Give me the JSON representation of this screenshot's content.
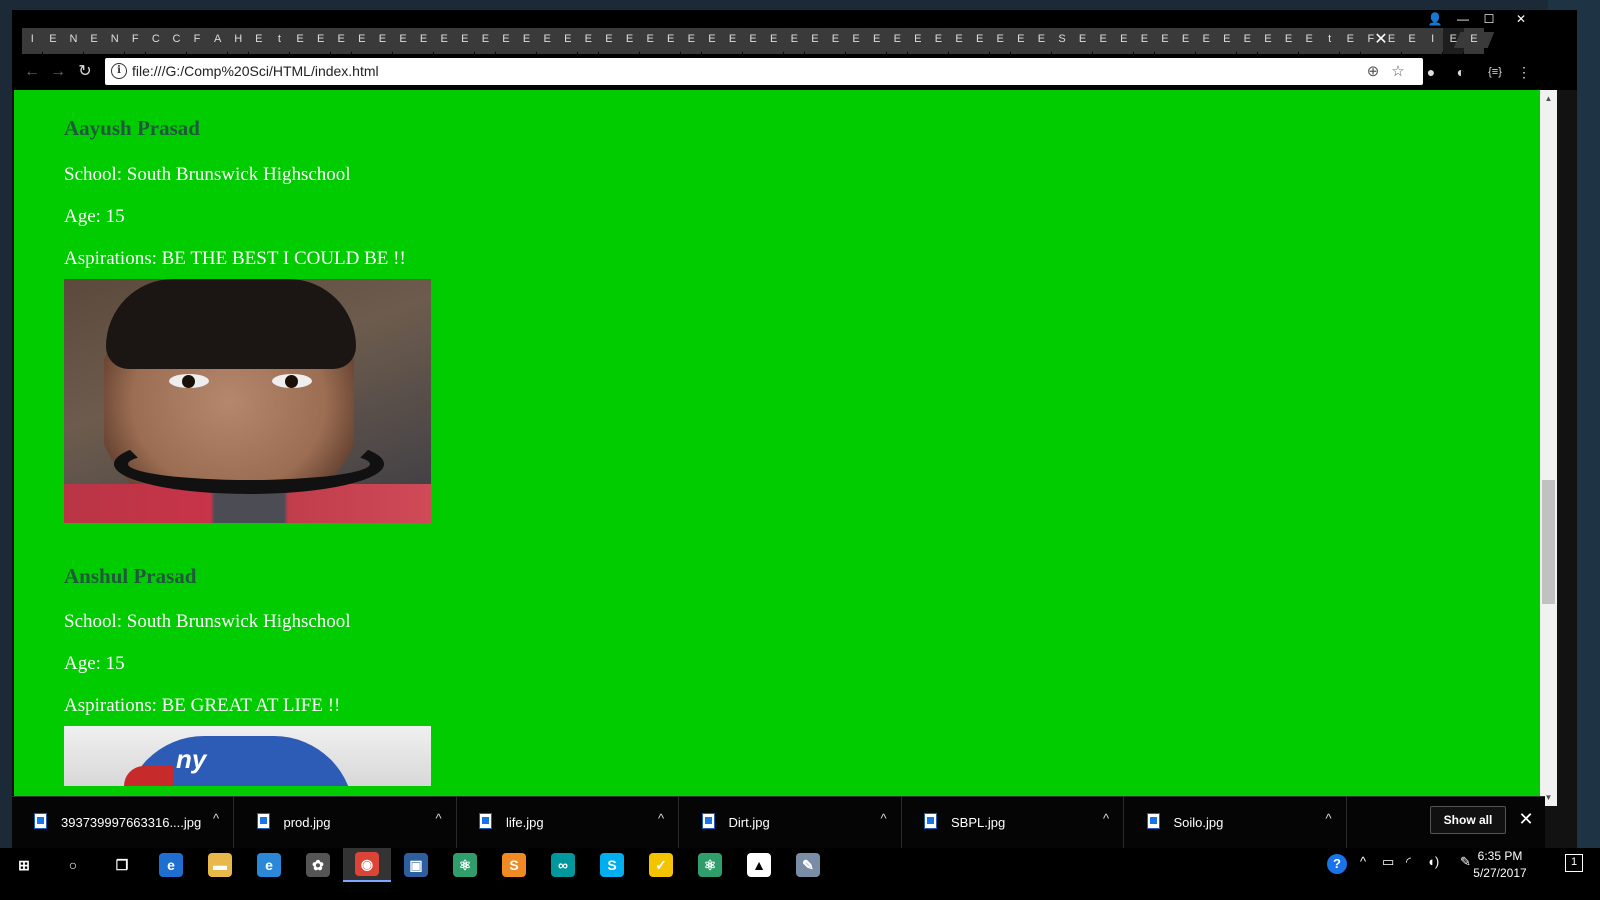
{
  "browser": {
    "tab_letters": [
      "I",
      "E",
      "N",
      "E",
      "N",
      "F",
      "C",
      "C",
      "F",
      "A",
      "H",
      "E",
      "t",
      "E",
      "E",
      "E",
      "E",
      "E",
      "E",
      "E",
      "E",
      "E",
      "E",
      "E",
      "E",
      "E",
      "E",
      "E",
      "E",
      "E",
      "E",
      "E",
      "E",
      "E",
      "E",
      "E",
      "E",
      "E",
      "E",
      "E",
      "E",
      "E",
      "E",
      "E",
      "E",
      "E",
      "E",
      "E",
      "E",
      "E",
      "S",
      "E",
      "E",
      "E",
      "E",
      "E",
      "E",
      "E",
      "E",
      "E",
      "E",
      "E",
      "E",
      "t",
      "E",
      "F",
      "E",
      "E",
      "I",
      "E",
      "E"
    ],
    "tab_close": "✕",
    "url": "file:///G:/Comp%20Sci/HTML/index.html",
    "window_controls": {
      "profile": "👤",
      "minimize": "—",
      "maximize": "☐",
      "close": "✕"
    },
    "nav": {
      "back": "←",
      "forward": "→",
      "reload": "↻"
    },
    "omnibox_icons": {
      "info": "i",
      "zoom": "⊕",
      "star": "☆"
    },
    "extensions": [
      "●",
      "◐",
      "{≡}",
      "⋮"
    ]
  },
  "page": {
    "people": [
      {
        "name": "Aayush Prasad",
        "school": "School: South Brunswick Highschool",
        "age": "Age: 15",
        "aspirations": "Aspirations: BE THE BEST I COULD BE !!"
      },
      {
        "name": "Anshul Prasad",
        "school": "School: South Brunswick Highschool",
        "age": "Age: 15",
        "aspirations": "Aspirations: BE GREAT AT LIFE !!",
        "cap_logo": "ny"
      }
    ]
  },
  "scrollbar": {
    "up": "▲",
    "down": "▼"
  },
  "downloads": {
    "items": [
      "393739997663316....jpg",
      "prod.jpg",
      "life.jpg",
      "Dirt.jpg",
      "SBPL.jpg",
      "Soilo.jpg"
    ],
    "caret": "^",
    "show_all": "Show all",
    "close": "✕"
  },
  "taskbar": {
    "apps": [
      {
        "icon": "windows-start-icon",
        "glyph": "⊞",
        "color": "#000000"
      },
      {
        "icon": "cortana-search-icon",
        "glyph": "○",
        "color": "#000000"
      },
      {
        "icon": "task-view-icon",
        "glyph": "❐",
        "color": "#000000"
      },
      {
        "icon": "edge-icon",
        "glyph": "e",
        "color": "#1f6fd1"
      },
      {
        "icon": "file-explorer-icon",
        "glyph": "▬",
        "color": "#e8b94a"
      },
      {
        "icon": "internet-explorer-icon",
        "glyph": "e",
        "color": "#2b88d8"
      },
      {
        "icon": "paint-3d-icon",
        "glyph": "✿",
        "color": "#555555"
      },
      {
        "icon": "chrome-icon",
        "glyph": "◉",
        "color": "#db4437"
      },
      {
        "icon": "virtualbox-icon",
        "glyph": "▣",
        "color": "#2d5f9e"
      },
      {
        "icon": "atom-icon",
        "glyph": "⚛",
        "color": "#2f9e6b"
      },
      {
        "icon": "sublime-text-icon",
        "glyph": "S",
        "color": "#f08a24"
      },
      {
        "icon": "arduino-icon",
        "glyph": "∞",
        "color": "#00979d"
      },
      {
        "icon": "skype-icon",
        "glyph": "S",
        "color": "#00aff0"
      },
      {
        "icon": "norton-icon",
        "glyph": "✓",
        "color": "#f5c400"
      },
      {
        "icon": "atom-icon-2",
        "glyph": "⚛",
        "color": "#2f9e6b"
      },
      {
        "icon": "photos-icon",
        "glyph": "▲",
        "color": "#ffffff"
      },
      {
        "icon": "paint-icon",
        "glyph": "✎",
        "color": "#7a8da6"
      }
    ],
    "tray_icons": [
      "?",
      "^",
      "▭",
      "◜",
      "◖)",
      "✎"
    ],
    "time": "6:35 PM",
    "date": "5/27/2017",
    "notifications": "1"
  }
}
